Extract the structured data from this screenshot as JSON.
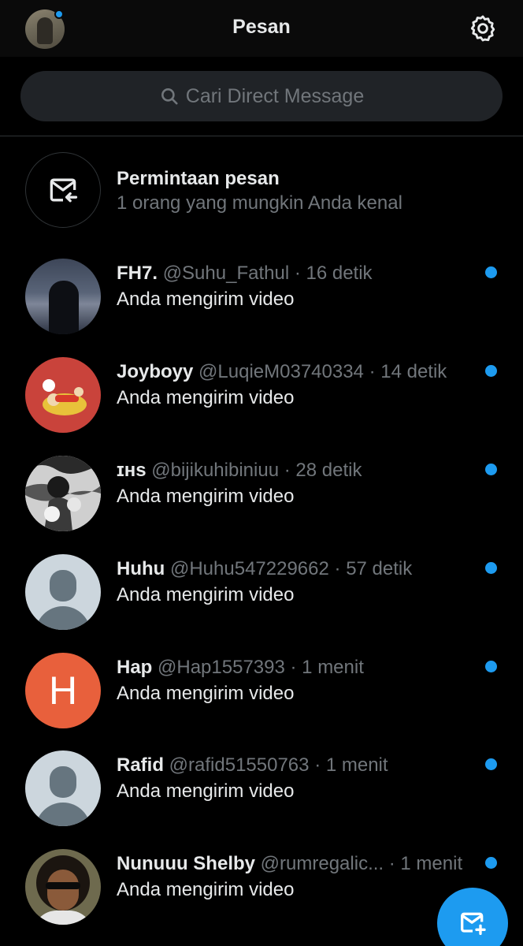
{
  "header": {
    "title": "Pesan",
    "avatar_icon": "profile-avatar",
    "settings_icon": "gear-icon"
  },
  "search": {
    "placeholder": "Cari Direct Message",
    "icon": "search-icon"
  },
  "requests": {
    "title": "Permintaan pesan",
    "subtitle": "1 orang yang mungkin Anda kenal",
    "icon": "envelope-arrow-icon"
  },
  "conversations": [
    {
      "name": "FH7.",
      "handle": "@Suhu_Fathul",
      "time": "· 16 detik",
      "preview": "Anda mengirim video",
      "unread": true
    },
    {
      "name": "Joyboyy",
      "handle": "@LuqieM03740334",
      "time": "· 14 detik",
      "preview": "Anda mengirim video",
      "unread": true
    },
    {
      "name": "ɪʜs",
      "handle": "@bijikuhibiniuu",
      "time": "· 28 detik",
      "preview": "Anda mengirim video",
      "unread": true
    },
    {
      "name": "Huhu",
      "handle": "@Huhu547229662",
      "time": "· 57 detik",
      "preview": "Anda mengirim video",
      "unread": true
    },
    {
      "name": "Hap",
      "handle": "@Hap1557393",
      "time": "· 1 menit",
      "preview": "Anda mengirim video",
      "unread": true,
      "avatar_letter": "H"
    },
    {
      "name": "Rafid",
      "handle": "@rafid51550763",
      "time": "· 1 menit",
      "preview": "Anda mengirim video",
      "unread": true
    },
    {
      "name": "Nunuuu Shelby",
      "handle": "@rumregalic...",
      "time": "· 1 menit",
      "preview": "Anda mengirim video",
      "unread": true
    }
  ],
  "fab": {
    "icon": "new-message-icon"
  },
  "colors": {
    "accent": "#1d9bf0",
    "background": "#000000",
    "muted_text": "#71767b"
  }
}
